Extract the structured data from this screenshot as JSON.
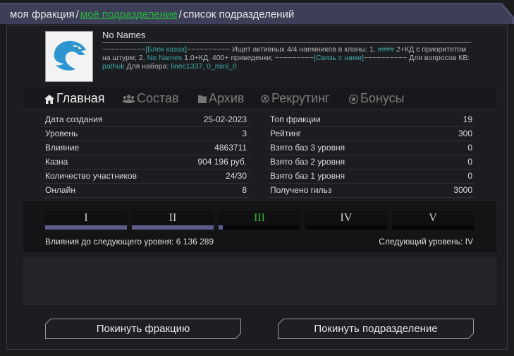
{
  "breadcrumb": {
    "items": [
      "моя фракция",
      "моё подразделение",
      "список подразделений"
    ],
    "separator": "/",
    "active_color": "#27b537"
  },
  "faction": {
    "name": "No Names",
    "logo_icon": "eagle-icon",
    "description": {
      "p1": "~~~~~~~~~~",
      "p2": "[Блок казах]",
      "p3": "~~~~~~~~~~ Ищет активных 4/4 наемников в кланы: 1. ",
      "p4": "####",
      "p5": " 2+КД с приоритетом на штурм; 2. ",
      "p6": "No Names",
      "p7": " 1.0+КД, 400+ приведенки;  ~~~~~~~~~",
      "p8": "[Связь с нами]",
      "p9": "~~~~~~~~~~ Для вопросов КВ: ",
      "p10": "pathuk",
      "p11": " Для набора: ",
      "p12": "linec1337, 0_mini_0"
    }
  },
  "tabs": [
    {
      "label": "Главная",
      "icon": "home-icon"
    },
    {
      "label": "Состав",
      "icon": "users-icon"
    },
    {
      "label": "Архив",
      "icon": "folder-icon"
    },
    {
      "label": "Рекрутинг",
      "icon": "recruit-icon"
    },
    {
      "label": "Бонусы",
      "icon": "star-badge-icon"
    }
  ],
  "stats_left": [
    {
      "label": "Дата создания",
      "value": "25-02-2023"
    },
    {
      "label": "Уровень",
      "value": "3"
    },
    {
      "label": "Влияние",
      "value": "4863711"
    },
    {
      "label": "Казна",
      "value": "904 196 руб."
    },
    {
      "label": "Количество участников",
      "value": "24/30"
    },
    {
      "label": "Онлайн",
      "value": "8"
    }
  ],
  "stats_right": [
    {
      "label": "Топ фракции",
      "value": "19"
    },
    {
      "label": "Рейтинг",
      "value": "300"
    },
    {
      "label": "Взято баз 3 уровня",
      "value": "0"
    },
    {
      "label": "Взято баз 2 уровня",
      "value": "0"
    },
    {
      "label": "Взято баз 1 уровня",
      "value": "0"
    },
    {
      "label": "Получено гильз",
      "value": "3000"
    }
  ],
  "levels": {
    "items": [
      {
        "label": "I",
        "progress": 1.0
      },
      {
        "label": "II",
        "progress": 1.0
      },
      {
        "label": "III",
        "progress": 0.05
      },
      {
        "label": "IV",
        "progress": 0
      },
      {
        "label": "V",
        "progress": 0
      }
    ],
    "current_index": 2,
    "bar_color": "#5b5c8a",
    "influence_to_next": "Влияния до следующего уровня: 6 136 289",
    "next_level": "Следующий уровень: IV"
  },
  "buttons": {
    "leave_faction": "Покинуть фракцию",
    "leave_division": "Покинуть подразделение"
  }
}
